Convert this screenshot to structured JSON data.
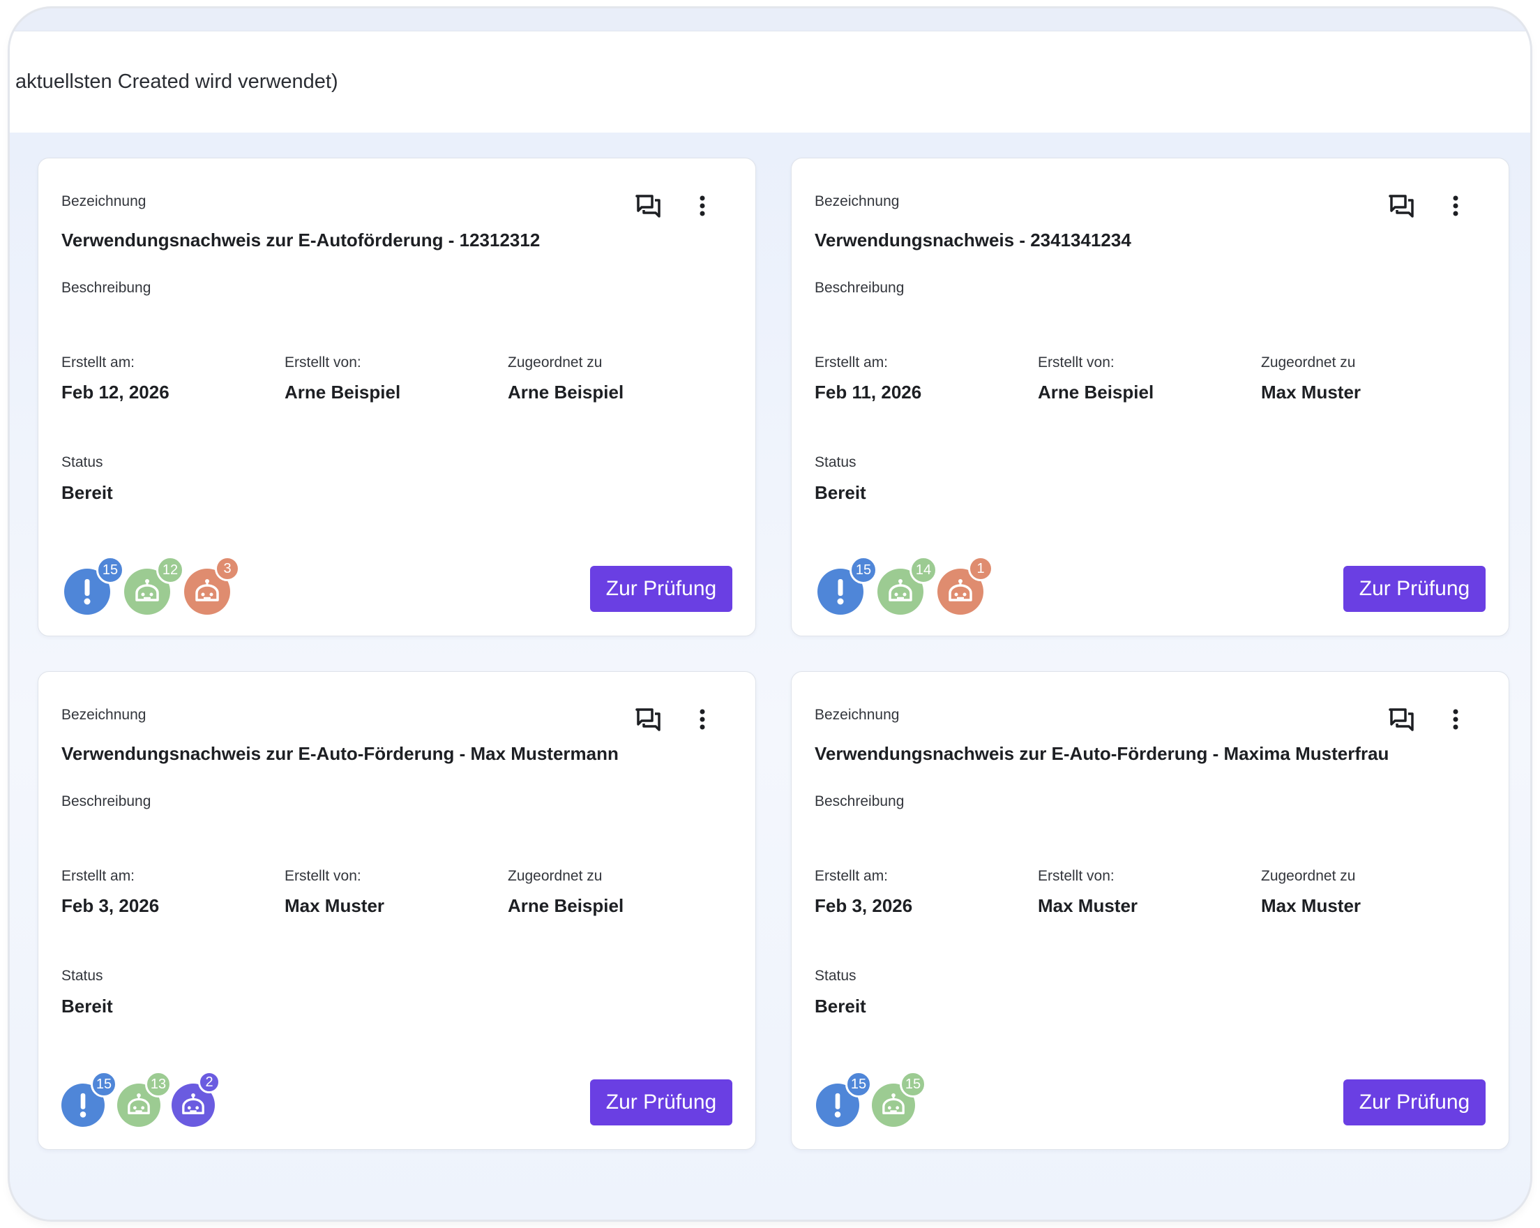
{
  "header": {
    "text": "aktuellsten Created wird verwendet)"
  },
  "labels": {
    "bezeichnung": "Bezeichnung",
    "beschreibung": "Beschreibung",
    "erstellt_am": "Erstellt am:",
    "erstellt_von": "Erstellt von:",
    "zugeordnet": "Zugeordnet zu",
    "status": "Status",
    "button": "Zur Prüfung"
  },
  "colors": {
    "accent": "#6a3fe3",
    "badge_blue": "#4f86d8",
    "badge_green": "#9ccb92",
    "badge_orange": "#df8c6f",
    "badge_purple": "#6a5be0"
  },
  "cards": [
    {
      "title": "Verwendungsnachweis zur E-Autoförderung - 12312312",
      "created_at": "Feb 12, 2026",
      "created_by": "Arne Beispiel",
      "assigned_to": "Arne Beispiel",
      "status": "Bereit",
      "badges": [
        {
          "icon": "alert-icon",
          "color": "blue",
          "count": "15"
        },
        {
          "icon": "robot-icon",
          "color": "green",
          "count": "12"
        },
        {
          "icon": "robot-icon",
          "color": "orange",
          "count": "3"
        }
      ]
    },
    {
      "title": "Verwendungsnachweis - 2341341234",
      "created_at": "Feb 11, 2026",
      "created_by": "Arne Beispiel",
      "assigned_to": "Max Muster",
      "status": "Bereit",
      "badges": [
        {
          "icon": "alert-icon",
          "color": "blue",
          "count": "15"
        },
        {
          "icon": "robot-icon",
          "color": "green",
          "count": "14"
        },
        {
          "icon": "robot-icon",
          "color": "orange",
          "count": "1"
        }
      ]
    },
    {
      "title": "Verwendungsnachweis zur E-Auto-Förderung - Max Mustermann",
      "created_at": "Feb 3, 2026",
      "created_by": "Max Muster",
      "assigned_to": "Arne Beispiel",
      "status": "Bereit",
      "badges": [
        {
          "icon": "alert-icon",
          "color": "blue",
          "count": "15"
        },
        {
          "icon": "robot-icon",
          "color": "green",
          "count": "13"
        },
        {
          "icon": "robot-icon",
          "color": "purple",
          "count": "2"
        }
      ]
    },
    {
      "title": "Verwendungsnachweis zur E-Auto-Förderung - Maxima Musterfrau",
      "created_at": "Feb 3, 2026",
      "created_by": "Max Muster",
      "assigned_to": "Max Muster",
      "status": "Bereit",
      "badges": [
        {
          "icon": "alert-icon",
          "color": "blue",
          "count": "15"
        },
        {
          "icon": "robot-icon",
          "color": "green",
          "count": "15"
        }
      ]
    }
  ]
}
